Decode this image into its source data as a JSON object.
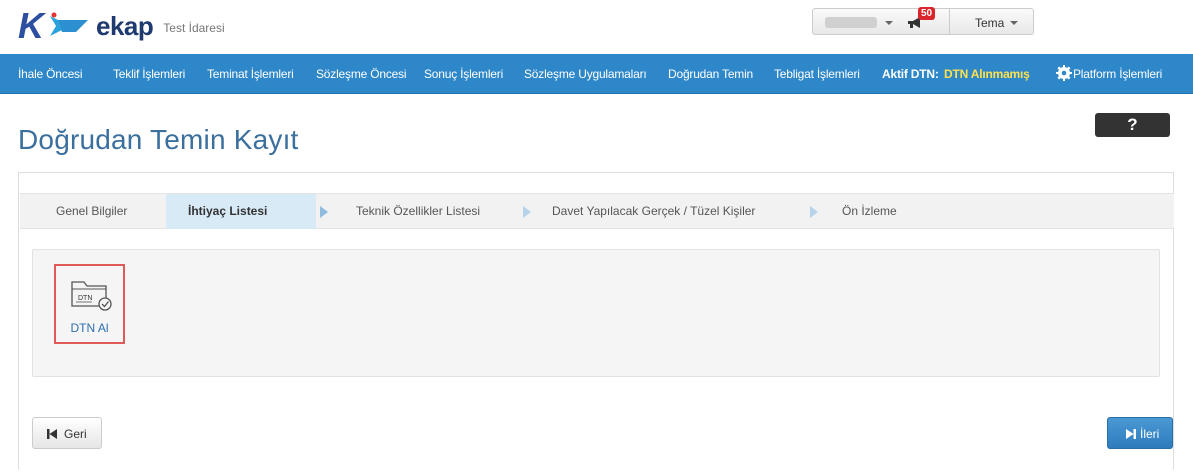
{
  "header": {
    "brand_k": "K",
    "brand_word": "ekap",
    "brand_sub": "Test İdaresi",
    "notification_count": "50",
    "theme_label": "Tema"
  },
  "nav": {
    "items": [
      "İhale Öncesi",
      "Teklif İşlemleri",
      "Teminat İşlemleri",
      "Sözleşme Öncesi",
      "Sonuç İşlemleri",
      "Sözleşme Uygulamaları",
      "Doğrudan Temin",
      "Tebligat İşlemleri"
    ],
    "active_dtn_label": "Aktif DTN:",
    "active_dtn_value": "DTN Alınmamış",
    "platform_label": "Platform İşlemleri"
  },
  "page": {
    "title": "Doğrudan Temin Kayıt",
    "help_label": "?"
  },
  "wizard": {
    "steps": [
      "Genel Bilgiler",
      "İhtiyaç Listesi",
      "Teknik Özellikler Listesi",
      "Davet Yapılacak Gerçek / Tüzel Kişiler",
      "Ön İzleme"
    ],
    "active_step": 1
  },
  "content": {
    "card_label": "DTN Al",
    "card_icon_text": "DTN"
  },
  "buttons": {
    "back_label": "Geri",
    "next_label": "İleri"
  },
  "colors": {
    "navbar": "#2e87c8",
    "active_dtn": "#ffe14d",
    "title": "#3a6f9e",
    "highlight_border": "#e05a5a"
  }
}
